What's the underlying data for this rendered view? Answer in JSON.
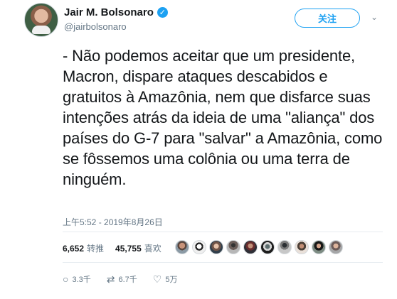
{
  "author": {
    "name": "Jair M. Bolsonaro",
    "handle": "@jairbolsonaro",
    "verified_icon": "verified-badge"
  },
  "follow_label": "关注",
  "tweet": {
    "text": "- Não podemos aceitar que um presidente, Macron, dispare ataques descabidos e gratuitos à Amazônia, nem que disfarce suas intenções atrás da ideia de uma \"aliança\" dos países do G-7 para \"salvar\" a Amazônia, como se fôssemos uma colônia ou uma terra de ninguém.",
    "timestamp": "上午5:52 - 2019年8月26日"
  },
  "stats": {
    "retweets_value": "6,652",
    "retweets_label": "转推",
    "likes_value": "45,755",
    "likes_label": "喜欢"
  },
  "actions": {
    "reply_count": "3.3千",
    "retweet_count": "6.7千",
    "like_count": "5万"
  },
  "colors": {
    "accent": "#1da1f2",
    "text": "#14171a",
    "muted": "#657786",
    "divider": "#e6ecf0"
  }
}
